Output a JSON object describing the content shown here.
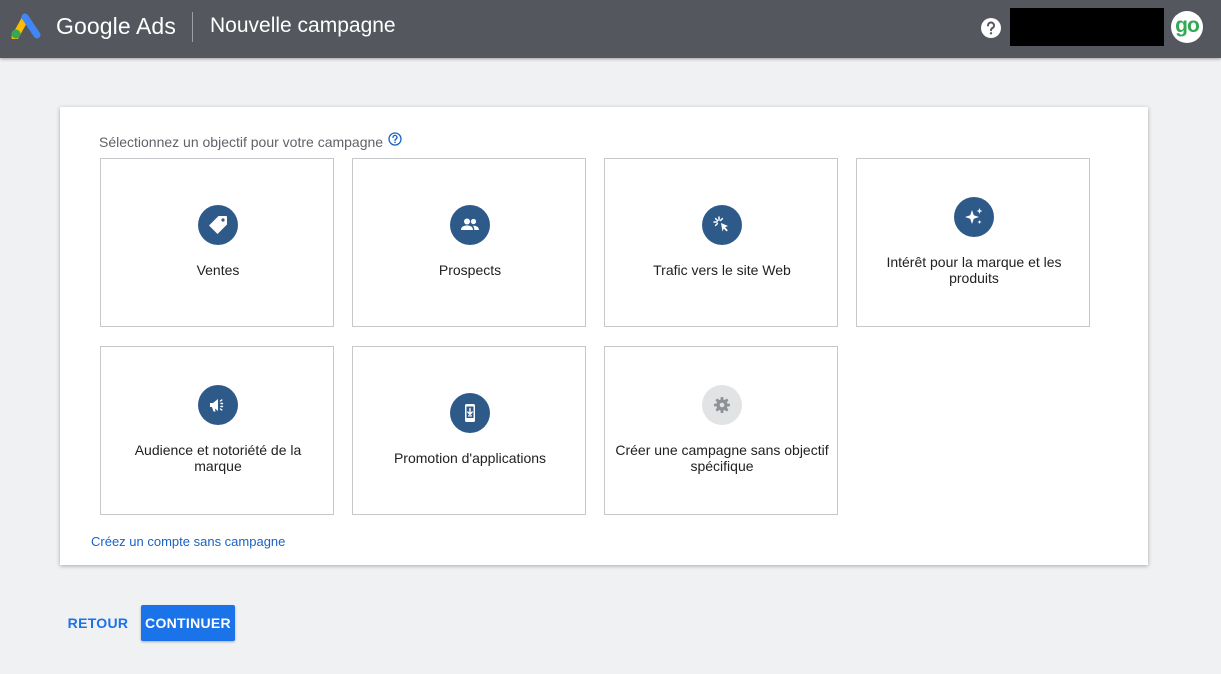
{
  "header": {
    "brand": "Google Ads",
    "page_title": "Nouvelle campagne",
    "avatar_text": "go"
  },
  "card": {
    "prompt": "Sélectionnez un objectif pour votre campagne",
    "objectives": [
      {
        "label": "Ventes",
        "icon": "tag-icon"
      },
      {
        "label": "Prospects",
        "icon": "people-icon"
      },
      {
        "label": "Trafic vers le site Web",
        "icon": "cursor-click-icon"
      },
      {
        "label": "Intérêt pour la marque et les produits",
        "icon": "sparkle-icon"
      },
      {
        "label": "Audience et notoriété de la marque",
        "icon": "megaphone-icon"
      },
      {
        "label": "Promotion d'applications",
        "icon": "mobile-download-icon"
      },
      {
        "label": "Créer une campagne sans objectif spécifique",
        "icon": "gear-icon"
      }
    ],
    "no_campaign_link": "Créez un compte sans campagne"
  },
  "footer": {
    "back_label": "RETOUR",
    "continue_label": "CONTINUER"
  },
  "colors": {
    "header_bg": "#54575e",
    "icon_circle": "#2e5a8a",
    "accent": "#1a73e8",
    "page_bg": "#f0f1f3"
  }
}
